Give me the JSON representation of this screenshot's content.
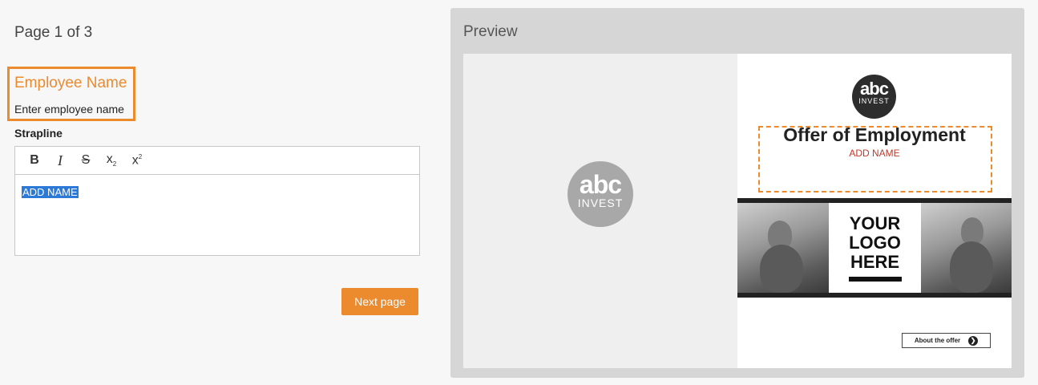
{
  "form": {
    "page_indicator": "Page 1 of 3",
    "field_title": "Employee Name",
    "field_description": "Enter employee name",
    "strapline_label": "Strapline",
    "toolbar": {
      "bold": "B",
      "italic": "I",
      "strike": "S",
      "subscript": "x",
      "subscript_mark": "2",
      "superscript": "x",
      "superscript_mark": "2"
    },
    "editor_value": "ADD NAME",
    "next_button": "Next page"
  },
  "preview": {
    "title": "Preview",
    "logo_main": "abc",
    "logo_sub": "INVEST",
    "offer_title": "Offer of Employment",
    "offer_name": "ADD NAME",
    "logo_placeholder": [
      "YOUR",
      "LOGO",
      "HERE"
    ],
    "about_button": "About the offer",
    "about_arrow": "❯"
  },
  "colors": {
    "accent": "#ec8a2e",
    "selection": "#2d79d8",
    "name_red": "#c0392b"
  }
}
